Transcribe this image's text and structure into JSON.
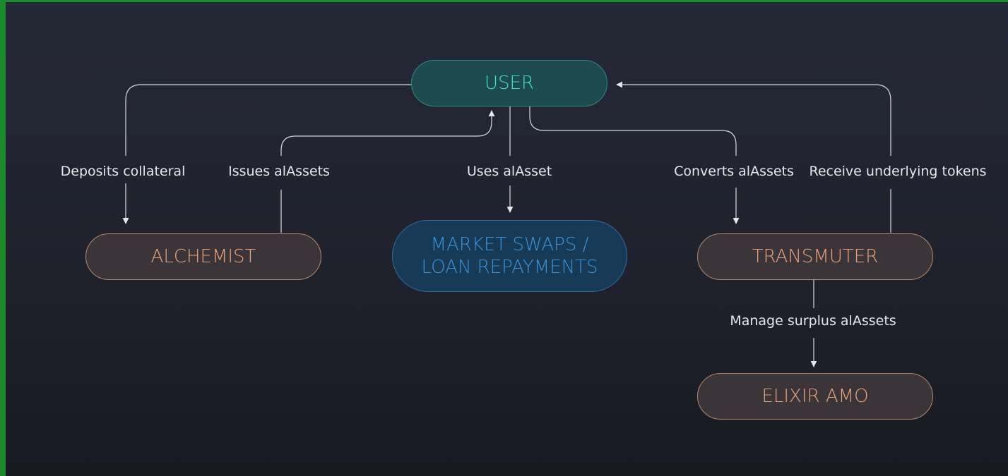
{
  "diagram": {
    "nodes": {
      "user": "USER",
      "alchemist": "ALCHEMIST",
      "market_line1": "MARKET SWAPS /",
      "market_line2": "LOAN REPAYMENTS",
      "transmuter": "TRANSMUTER",
      "elixir": "ELIXIR AMO"
    },
    "edges": {
      "deposits": "Deposits collateral",
      "issues": "Issues alAssets",
      "uses": "Uses alAsset",
      "converts": "Converts alAssets",
      "receive": "Receive underlying tokens",
      "manage": "Manage surplus alAssets"
    },
    "colors": {
      "background": "#22252f",
      "user_text": "#3ee0cf",
      "user_fill": "#1d4a4d",
      "brown_text": "#e8a27d",
      "brown_border": "#b6876c",
      "blue_text": "#3d8fd6",
      "blue_fill": "#173a56",
      "line": "#d9d9dd"
    }
  }
}
